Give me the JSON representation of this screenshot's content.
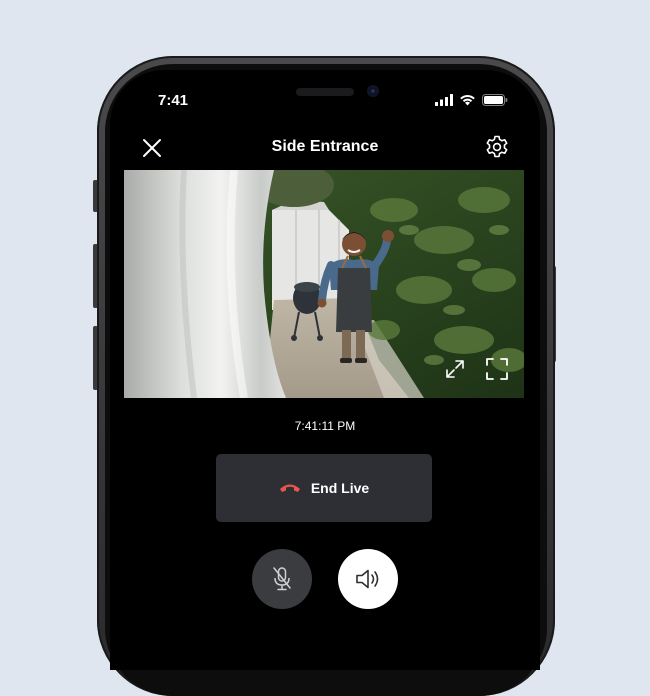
{
  "status_bar": {
    "time": "7:41"
  },
  "header": {
    "title": "Side Entrance"
  },
  "live": {
    "timestamp": "7:41:11 PM"
  },
  "controls": {
    "end_live_label": "End Live"
  },
  "colors": {
    "background": "#dfe6ef",
    "end_call_icon": "#e8574a",
    "button_dark": "#2d2f34"
  },
  "icons": [
    "close-icon",
    "gear-icon",
    "expand-icon",
    "fullscreen-icon",
    "end-call-icon",
    "mic-muted-icon",
    "speaker-icon",
    "signal-icon",
    "wifi-icon",
    "battery-icon"
  ]
}
